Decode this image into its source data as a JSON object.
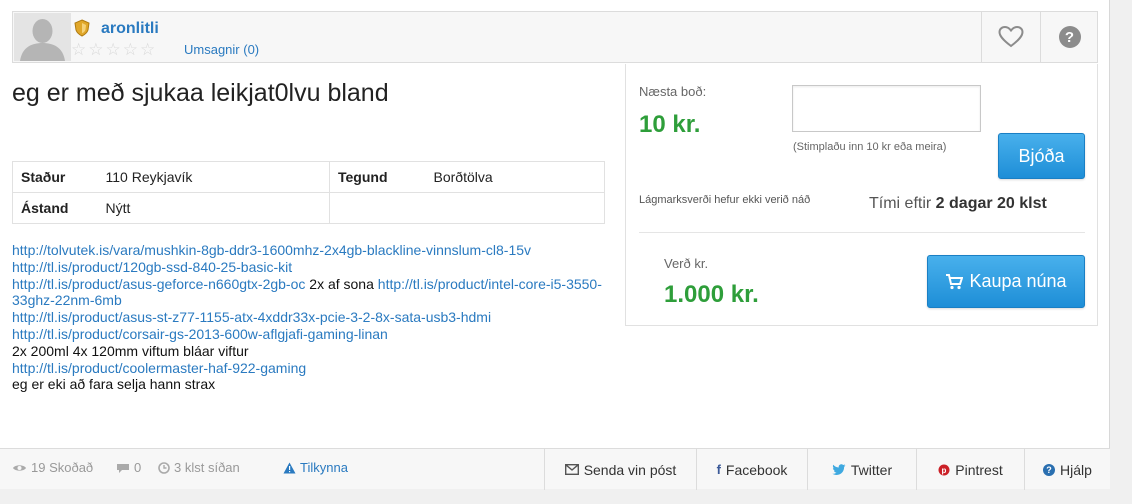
{
  "seller": {
    "username": "aronlitli",
    "reviews_label": "Umsagnir (0)",
    "stars": [
      "☆",
      "☆",
      "☆",
      "☆",
      "☆"
    ],
    "avatar_icon": "user-silhouette-icon",
    "badge_icon": "shield-badge-icon"
  },
  "listing": {
    "title": "eg er með sjukaa leikjat0lvu bland",
    "attributes": {
      "location_label": "Staður",
      "location_value": "110 Reykjavík",
      "type_label": "Tegund",
      "type_value": "Borðtölva",
      "condition_label": "Ástand",
      "condition_value": "Nýtt"
    },
    "description": {
      "link1": "http://tolvutek.is/vara/mushkin-8gb-ddr3-1600mhz-2x4gb-blackline-vinnslum-cl8-15v",
      "link2": "http://tl.is/product/120gb-ssd-840-25-basic-kit",
      "link3": "http://tl.is/product/asus-geforce-n660gtx-2gb-oc",
      "text3": " 2x af sona ",
      "link4": "http://tl.is/product/intel-core-i5-3550-33ghz-22nm-6mb",
      "link5": "http://tl.is/product/asus-st-z77-1155-atx-4xddr33x-pcie-3-2-8x-sata-usb3-hdmi",
      "link6": "http://tl.is/product/corsair-gs-2013-600w-aflgjafi-gaming-linan",
      "text6": "2x 200ml 4x 120mm viftum bláar viftur",
      "link7": "http://tl.is/product/coolermaster-haf-922-gaming",
      "text7": "eg er eki að fara selja hann strax"
    }
  },
  "bid": {
    "next_bid_label": "Næsta boð:",
    "next_bid_value": "10 kr.",
    "input_value": "",
    "hint": "(Stimplaðu inn 10 kr eða meira)",
    "bid_button": "Bjóða",
    "reserve_text": "Lágmarksverði hefur ekki verið náð",
    "time_label": "Tími eftir",
    "time_value": "2 dagar 20 klst",
    "price_label": "Verð kr.",
    "price_value": "1.000 kr.",
    "buy_button": "Kaupa núna"
  },
  "footer": {
    "views": "19 Skoðað",
    "comments": "0",
    "posted": "3 klst síðan",
    "report": "Tilkynna",
    "email": "Senda vin póst",
    "facebook": "Facebook",
    "twitter": "Twitter",
    "pinterest": "Pintrest",
    "help": "Hjálp"
  },
  "colors": {
    "link": "#2a7ac0",
    "price_green": "#2e9e3a",
    "button_blue": "#1e8ed7"
  }
}
